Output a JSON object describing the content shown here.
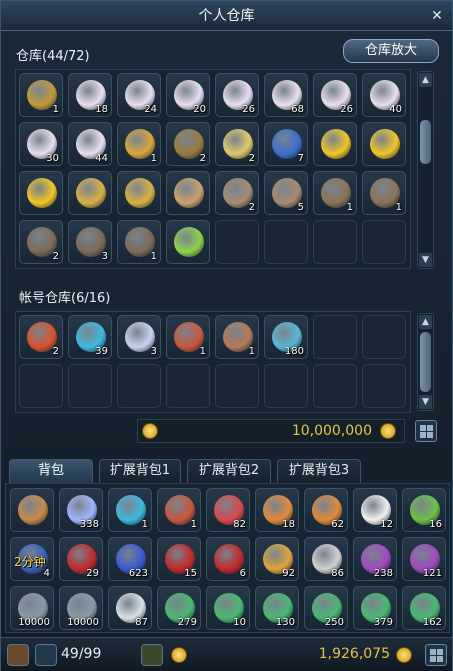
{
  "window": {
    "title": "个人仓库"
  },
  "personal": {
    "label": "仓库(44/72)",
    "expand_label": "仓库放大",
    "slots": [
      {
        "color": "#c39a3c",
        "count": "1"
      },
      {
        "color": "#e8dff0",
        "count": "18"
      },
      {
        "color": "#e8dff0",
        "count": "24"
      },
      {
        "color": "#e8dff0",
        "count": "20"
      },
      {
        "color": "#e8dff0",
        "count": "26"
      },
      {
        "color": "#e8dff0",
        "count": "68"
      },
      {
        "color": "#e8dff0",
        "count": "26"
      },
      {
        "color": "#e8dff0",
        "count": "40"
      },
      {
        "color": "#e8dff0",
        "count": "30"
      },
      {
        "color": "#e8dff0",
        "count": "44"
      },
      {
        "color": "#d8a73b",
        "count": "1"
      },
      {
        "color": "#9a7a40",
        "count": "2"
      },
      {
        "color": "#e3c76a",
        "count": "2"
      },
      {
        "color": "#3a6fd0",
        "count": "7"
      },
      {
        "color": "#f2c526",
        "count": ""
      },
      {
        "color": "#f2c526",
        "count": ""
      },
      {
        "color": "#f2c526",
        "count": ""
      },
      {
        "color": "#d9b145",
        "count": ""
      },
      {
        "color": "#d9b145",
        "count": ""
      },
      {
        "color": "#c9a16a",
        "count": ""
      },
      {
        "color": "#a88a70",
        "count": "2"
      },
      {
        "color": "#a88a70",
        "count": "5"
      },
      {
        "color": "#8c7355",
        "count": "1"
      },
      {
        "color": "#8c7355",
        "count": "1"
      },
      {
        "color": "#7c6a58",
        "count": "2"
      },
      {
        "color": "#7c6a58",
        "count": "3"
      },
      {
        "color": "#7c6a58",
        "count": "1"
      },
      {
        "color": "#8fd14a",
        "count": ""
      },
      {
        "color": "",
        "count": ""
      },
      {
        "color": "",
        "count": ""
      },
      {
        "color": "",
        "count": ""
      },
      {
        "color": "",
        "count": ""
      }
    ]
  },
  "account": {
    "label": "帐号仓库(6/16)",
    "money": "10,000,000",
    "slots": [
      {
        "color": "#d8542a",
        "count": "2"
      },
      {
        "color": "#3fb9e0",
        "count": "39"
      },
      {
        "color": "#c7d4ec",
        "count": "3"
      },
      {
        "color": "#c9573c",
        "count": "1"
      },
      {
        "color": "#b77a55",
        "count": "1"
      },
      {
        "color": "#59b8d6",
        "count": "180"
      },
      {
        "color": "",
        "count": ""
      },
      {
        "color": "",
        "count": ""
      },
      {
        "color": "",
        "count": ""
      },
      {
        "color": "",
        "count": ""
      },
      {
        "color": "",
        "count": ""
      },
      {
        "color": "",
        "count": ""
      },
      {
        "color": "",
        "count": ""
      },
      {
        "color": "",
        "count": ""
      },
      {
        "color": "",
        "count": ""
      },
      {
        "color": "",
        "count": ""
      }
    ]
  },
  "bag": {
    "tabs": [
      "背包",
      "扩展背包1",
      "扩展背包2",
      "扩展背包3"
    ],
    "active_tab": 0,
    "timer_text": "2分钟",
    "slots": [
      {
        "color": "#c88a4a",
        "count": ""
      },
      {
        "color": "#9fb6ff",
        "count": "338"
      },
      {
        "color": "#3fb9e0",
        "count": "1"
      },
      {
        "color": "#c9573c",
        "count": "1"
      },
      {
        "color": "#d94a4a",
        "count": "82"
      },
      {
        "color": "#e08a3a",
        "count": "18"
      },
      {
        "color": "#e08a3a",
        "count": "62"
      },
      {
        "color": "#f0f0f0",
        "count": "12"
      },
      {
        "color": "#6fbf4a",
        "count": "16"
      },
      {
        "color": "#3a60c0",
        "count": "4"
      },
      {
        "color": "#c22a2a",
        "count": "29"
      },
      {
        "color": "#3a5ad0",
        "count": "623"
      },
      {
        "color": "#c22a2a",
        "count": "15"
      },
      {
        "color": "#c22a2a",
        "count": "6"
      },
      {
        "color": "#e0a43a",
        "count": "92"
      },
      {
        "color": "#d0d0d0",
        "count": "86"
      },
      {
        "color": "#a04ac0",
        "count": "238"
      },
      {
        "color": "#a04ac0",
        "count": "121"
      },
      {
        "color": "#8a9aa8",
        "count": "10000"
      },
      {
        "color": "#8a9aa8",
        "count": "10000"
      },
      {
        "color": "#d8e0ea",
        "count": "87"
      },
      {
        "color": "#4ab870",
        "count": "279"
      },
      {
        "color": "#4ab870",
        "count": "10"
      },
      {
        "color": "#4ab870",
        "count": "130"
      },
      {
        "color": "#4ab870",
        "count": "250"
      },
      {
        "color": "#4ab870",
        "count": "379"
      },
      {
        "color": "#4ab870",
        "count": "162"
      }
    ],
    "capacity": "49/99",
    "money": "1,926,075"
  }
}
